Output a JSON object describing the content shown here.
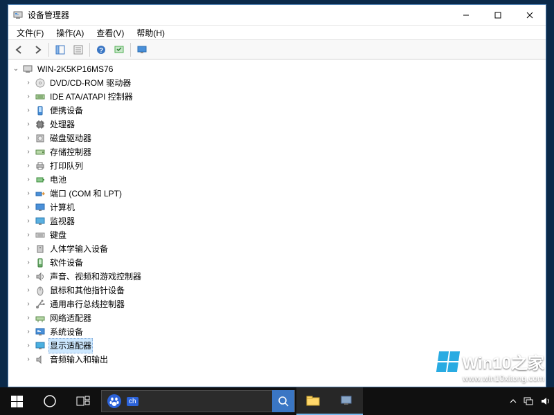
{
  "window": {
    "title": "设备管理器",
    "controls": {
      "min": "—",
      "max": "□",
      "close": "✕"
    }
  },
  "menu": {
    "items": [
      "文件(F)",
      "操作(A)",
      "查看(V)",
      "帮助(H)"
    ]
  },
  "tree": {
    "root": {
      "label": "WIN-2K5KP16MS76",
      "expanded": true
    },
    "nodes": [
      {
        "label": "DVD/CD-ROM 驱动器",
        "icon": "cd"
      },
      {
        "label": "IDE ATA/ATAPI 控制器",
        "icon": "ide"
      },
      {
        "label": "便携设备",
        "icon": "portable"
      },
      {
        "label": "处理器",
        "icon": "cpu"
      },
      {
        "label": "磁盘驱动器",
        "icon": "disk"
      },
      {
        "label": "存储控制器",
        "icon": "storage"
      },
      {
        "label": "打印队列",
        "icon": "printer"
      },
      {
        "label": "电池",
        "icon": "battery"
      },
      {
        "label": "端口 (COM 和 LPT)",
        "icon": "port"
      },
      {
        "label": "计算机",
        "icon": "computer"
      },
      {
        "label": "监视器",
        "icon": "monitor"
      },
      {
        "label": "键盘",
        "icon": "keyboard"
      },
      {
        "label": "人体学输入设备",
        "icon": "hid"
      },
      {
        "label": "软件设备",
        "icon": "software"
      },
      {
        "label": "声音、视频和游戏控制器",
        "icon": "sound"
      },
      {
        "label": "鼠标和其他指针设备",
        "icon": "mouse"
      },
      {
        "label": "通用串行总线控制器",
        "icon": "usb"
      },
      {
        "label": "网络适配器",
        "icon": "network"
      },
      {
        "label": "系统设备",
        "icon": "system"
      },
      {
        "label": "显示适配器",
        "icon": "display",
        "selected": true
      },
      {
        "label": "音频输入和输出",
        "icon": "audio"
      }
    ]
  },
  "watermark": {
    "brand": "Win10之家",
    "url": "www.win10xitong.com"
  },
  "taskbar": {
    "search_placeholder": ""
  }
}
